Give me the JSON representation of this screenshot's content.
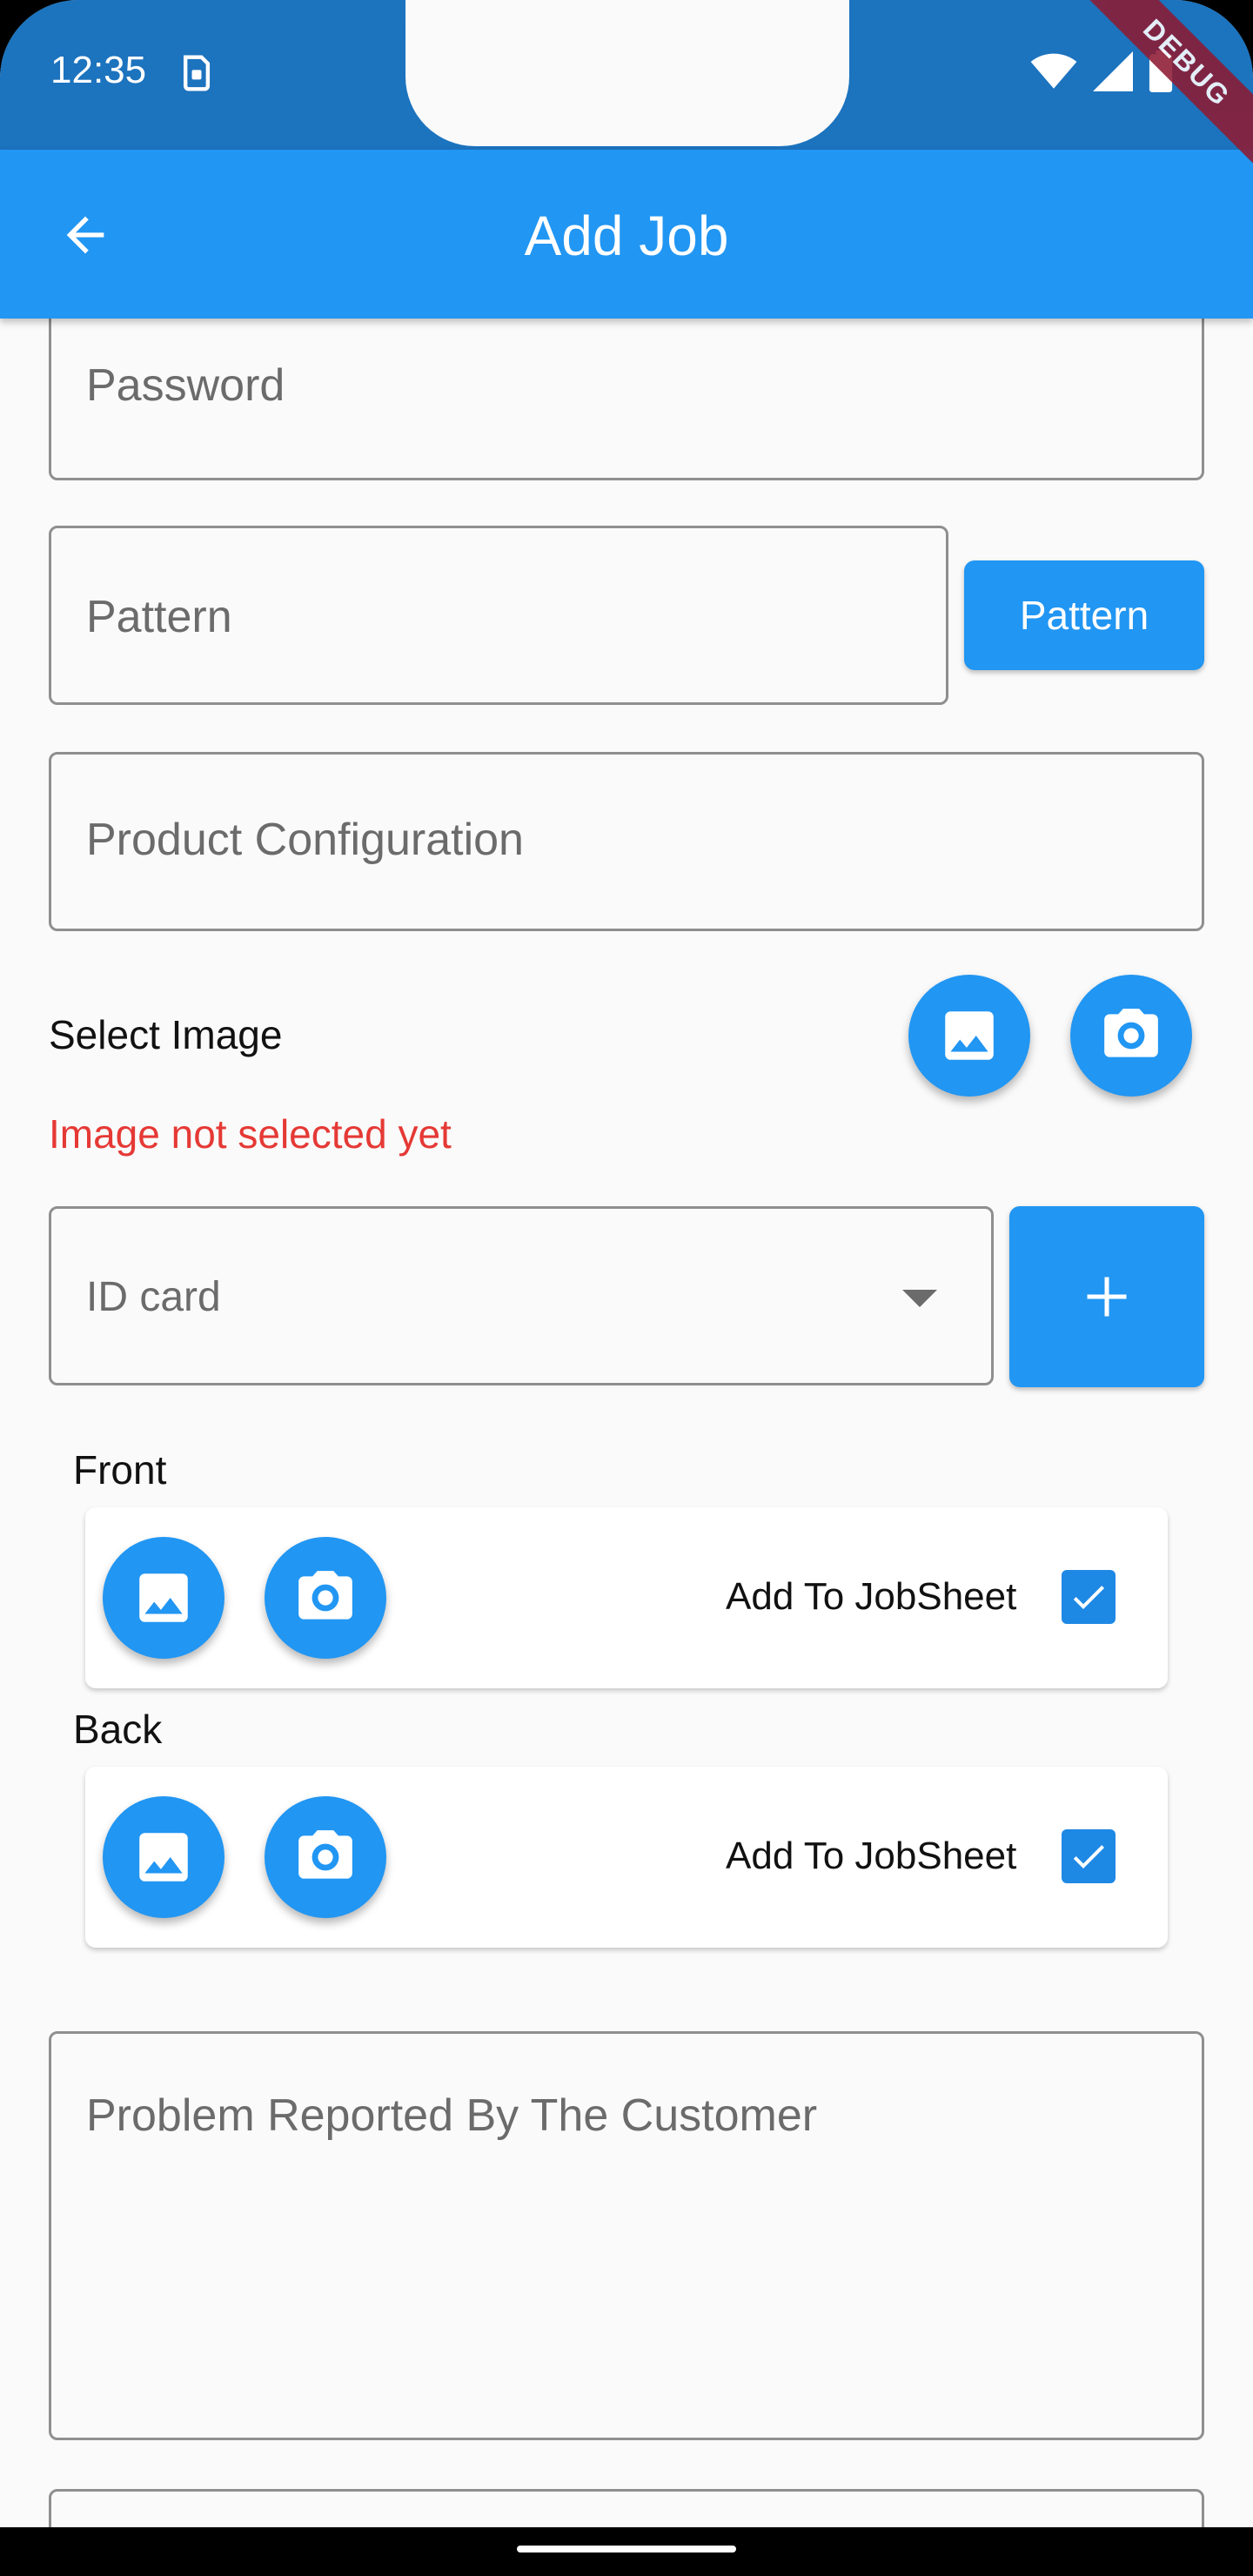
{
  "status": {
    "time": "12:35"
  },
  "debug_label": "DEBUG",
  "appbar": {
    "title": "Add Job"
  },
  "form": {
    "password_label": "Password",
    "pattern_label": "Pattern",
    "pattern_button": "Pattern",
    "product_config_label": "Product Configuration",
    "select_image_label": "Select Image",
    "image_error": "Image not selected yet",
    "id_type_value": "ID card",
    "front_label": "Front",
    "back_label": "Back",
    "add_to_jobsheet_front": "Add To JobSheet",
    "add_to_jobsheet_back": "Add To JobSheet",
    "problem_label": "Problem Reported By The Customer"
  },
  "colors": {
    "primary": "#2196F3",
    "statusbar": "#1C73BE",
    "error": "#E53935",
    "checkbox": "#1E88E5"
  }
}
